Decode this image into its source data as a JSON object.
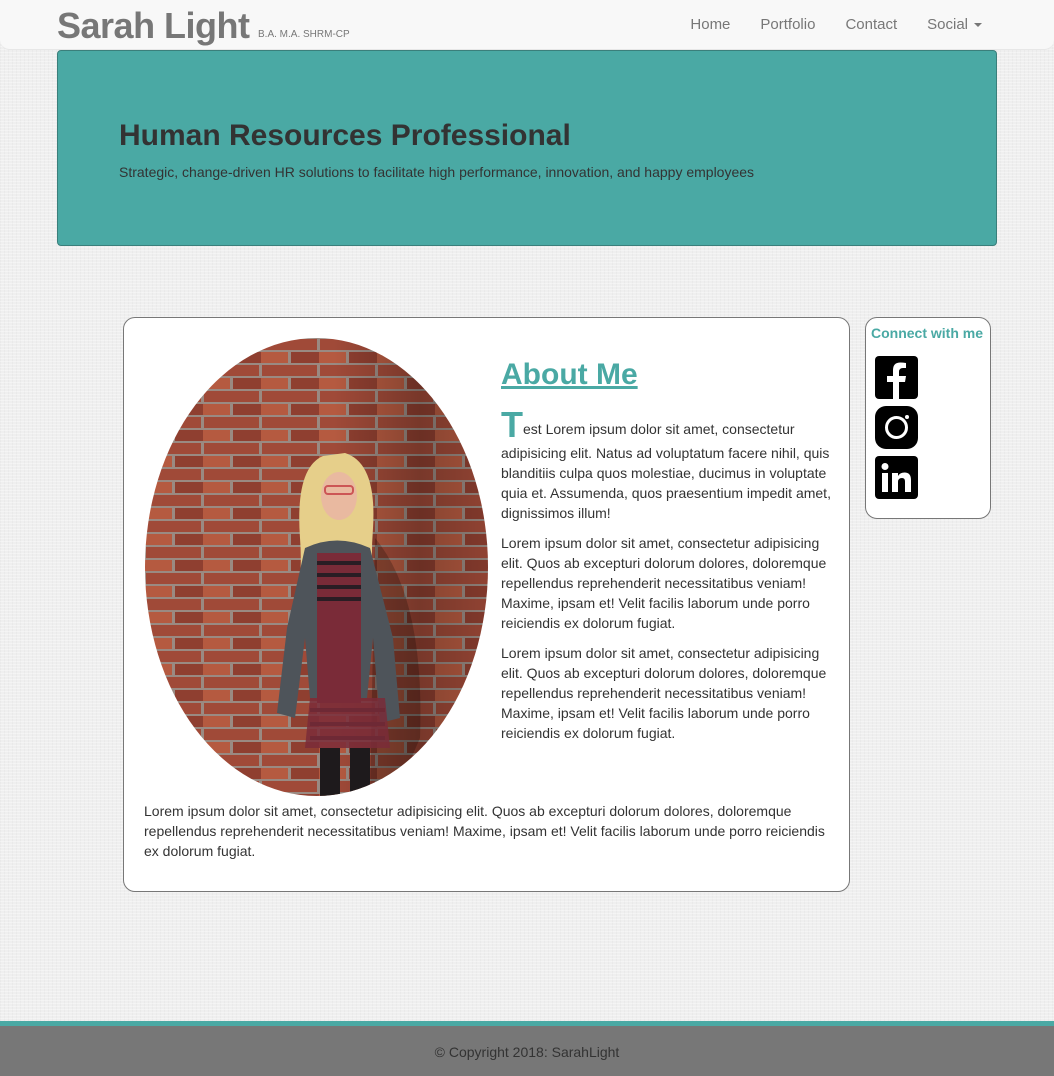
{
  "navbar": {
    "brand": "Sarah Light",
    "credentials": "B.A. M.A. SHRM-CP",
    "links": [
      {
        "label": "Home"
      },
      {
        "label": "Portfolio"
      },
      {
        "label": "Contact"
      },
      {
        "label": "Social"
      }
    ]
  },
  "hero": {
    "title": "Human Resources Professional",
    "subtitle": "Strategic, change-driven HR solutions to facilitate high performance, innovation, and happy employees"
  },
  "about": {
    "title": "About Me",
    "dropcap": "T",
    "para1_rest": "est Lorem ipsum dolor sit amet, consectetur adipisicing elit. Natus ad voluptatum facere nihil, quis blanditiis culpa quos molestiae, ducimus in voluptate quia et. Assumenda, quos praesentium impedit amet, dignissimos illum!",
    "para2": "Lorem ipsum dolor sit amet, consectetur adipisicing elit. Quos ab excepturi dolorum dolores, doloremque repellendus reprehenderit necessitatibus veniam! Maxime, ipsam et! Velit facilis laborum unde porro reiciendis ex dolorum fugiat.",
    "para3": "Lorem ipsum dolor sit amet, consectetur adipisicing elit. Quos ab excepturi dolorum dolores, doloremque repellendus reprehenderit necessitatibus veniam! Maxime, ipsam et! Velit facilis laborum unde porro reiciendis ex dolorum fugiat.",
    "para4": "Lorem ipsum dolor sit amet, consectetur adipisicing elit. Quos ab excepturi dolorum dolores, doloremque repellendus reprehenderit necessitatibus veniam! Maxime, ipsam et! Velit facilis laborum unde porro reiciendis ex dolorum fugiat."
  },
  "social": {
    "title": "Connect with me",
    "icons": [
      "facebook-icon",
      "instagram-icon",
      "linkedin-icon"
    ]
  },
  "footer": {
    "copyright": "© Copyright 2018: SarahLight"
  },
  "colors": {
    "accent": "#4aa9a4",
    "footer_bg": "#777777",
    "navbar_bg": "#f8f8f8"
  }
}
